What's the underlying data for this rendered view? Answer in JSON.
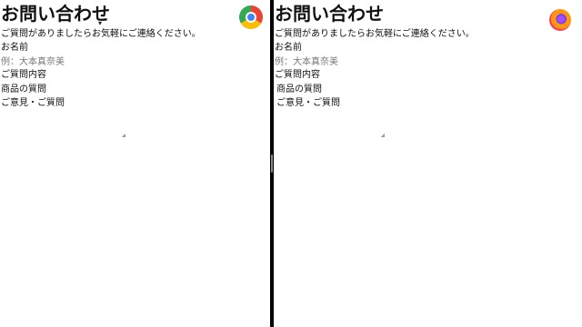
{
  "form": {
    "title": "お問い合わせ",
    "intro": "ご質問がありましたらお気軽にご連絡ください。",
    "name_label": "お名前",
    "name_placeholder": "例：大本真奈美",
    "name_value": "",
    "content_label": "ご質問内容",
    "options": [
      "商品の質問",
      "ご意見・ご質問"
    ]
  },
  "icons": {
    "left_browser": "chrome-icon",
    "right_browser": "firefox-icon"
  },
  "colors": {
    "background": "#ffffff",
    "divider": "#000000",
    "placeholder": "#777777"
  }
}
